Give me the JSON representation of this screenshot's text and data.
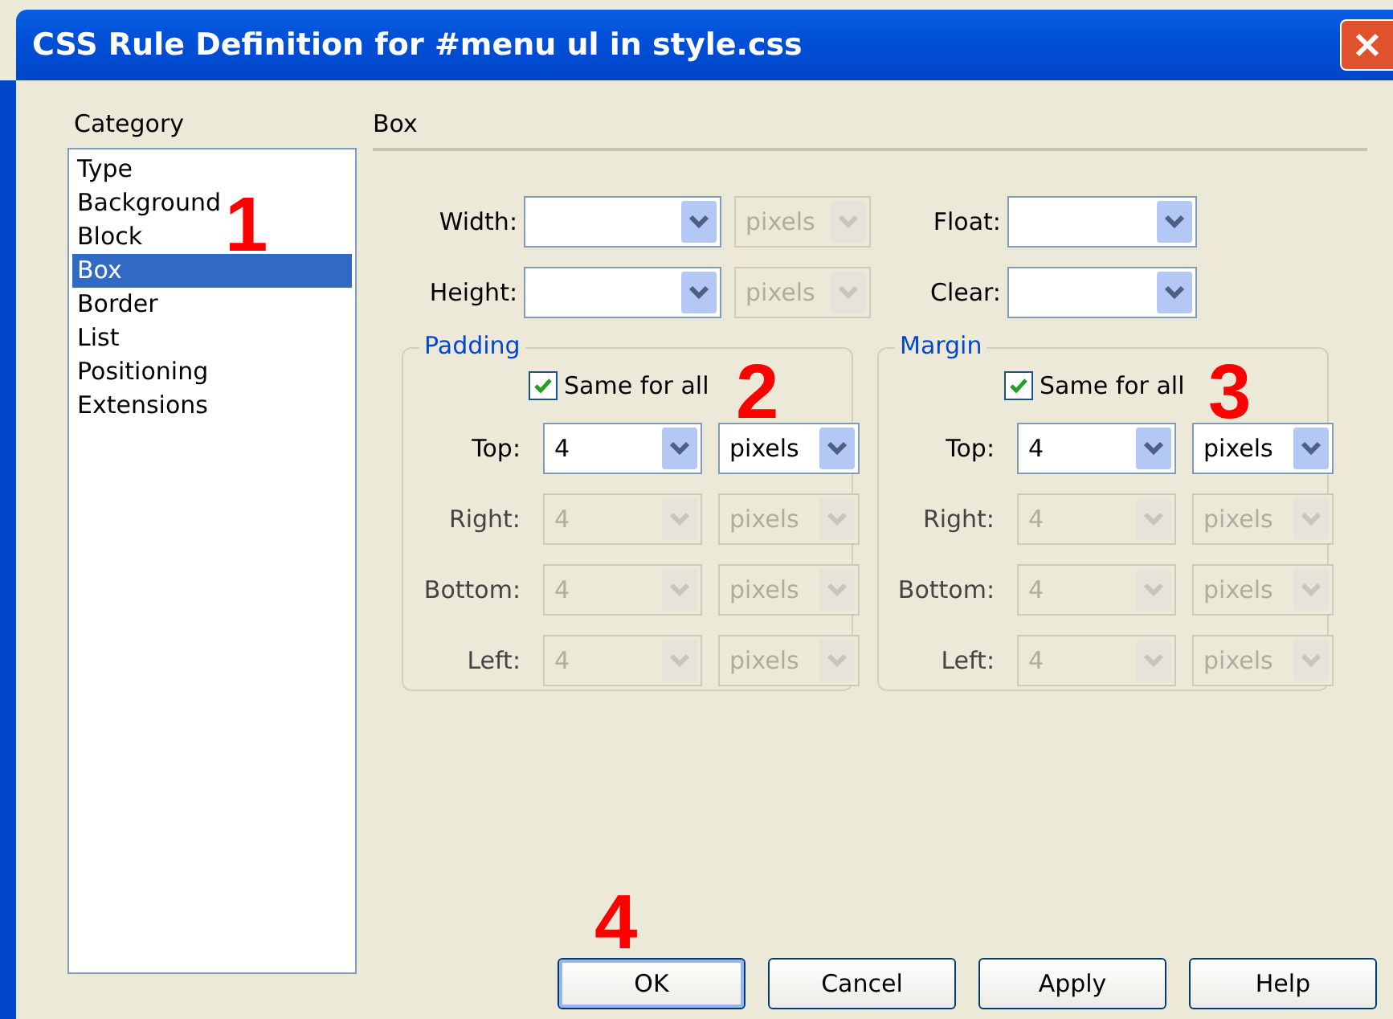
{
  "window": {
    "title": "CSS Rule Definition for #menu ul in style.css"
  },
  "category": {
    "heading": "Category",
    "items": [
      {
        "label": "Type",
        "selected": false
      },
      {
        "label": "Background",
        "selected": false
      },
      {
        "label": "Block",
        "selected": false
      },
      {
        "label": "Box",
        "selected": true
      },
      {
        "label": "Border",
        "selected": false
      },
      {
        "label": "List",
        "selected": false
      },
      {
        "label": "Positioning",
        "selected": false
      },
      {
        "label": "Extensions",
        "selected": false
      }
    ]
  },
  "panel": {
    "heading": "Box",
    "size_rows": [
      {
        "left": {
          "label": "Width:",
          "unit": "pixels",
          "unit_disabled": true
        },
        "right": {
          "label": "Float:"
        }
      },
      {
        "left": {
          "label": "Height:",
          "unit": "pixels",
          "unit_disabled": true
        },
        "right": {
          "label": "Clear:"
        }
      }
    ],
    "groups": [
      {
        "title": "Padding",
        "same_for_all": {
          "label": "Same for all",
          "checked": true
        },
        "sides": [
          {
            "label": "Top:",
            "value": "4",
            "unit": "pixels",
            "disabled": false
          },
          {
            "label": "Right:",
            "value": "4",
            "unit": "pixels",
            "disabled": true
          },
          {
            "label": "Bottom:",
            "value": "4",
            "unit": "pixels",
            "disabled": true
          },
          {
            "label": "Left:",
            "value": "4",
            "unit": "pixels",
            "disabled": true
          }
        ]
      },
      {
        "title": "Margin",
        "same_for_all": {
          "label": "Same for all",
          "checked": true
        },
        "sides": [
          {
            "label": "Top:",
            "value": "4",
            "unit": "pixels",
            "disabled": false
          },
          {
            "label": "Right:",
            "value": "4",
            "unit": "pixels",
            "disabled": true
          },
          {
            "label": "Bottom:",
            "value": "4",
            "unit": "pixels",
            "disabled": true
          },
          {
            "label": "Left:",
            "value": "4",
            "unit": "pixels",
            "disabled": true
          }
        ]
      }
    ]
  },
  "buttons": [
    {
      "label": "OK",
      "default": true
    },
    {
      "label": "Cancel",
      "default": false
    },
    {
      "label": "Apply",
      "default": false
    },
    {
      "label": "Help",
      "default": false
    }
  ],
  "annotations": [
    {
      "label": "1"
    },
    {
      "label": "2"
    },
    {
      "label": "3"
    },
    {
      "label": "4"
    }
  ]
}
